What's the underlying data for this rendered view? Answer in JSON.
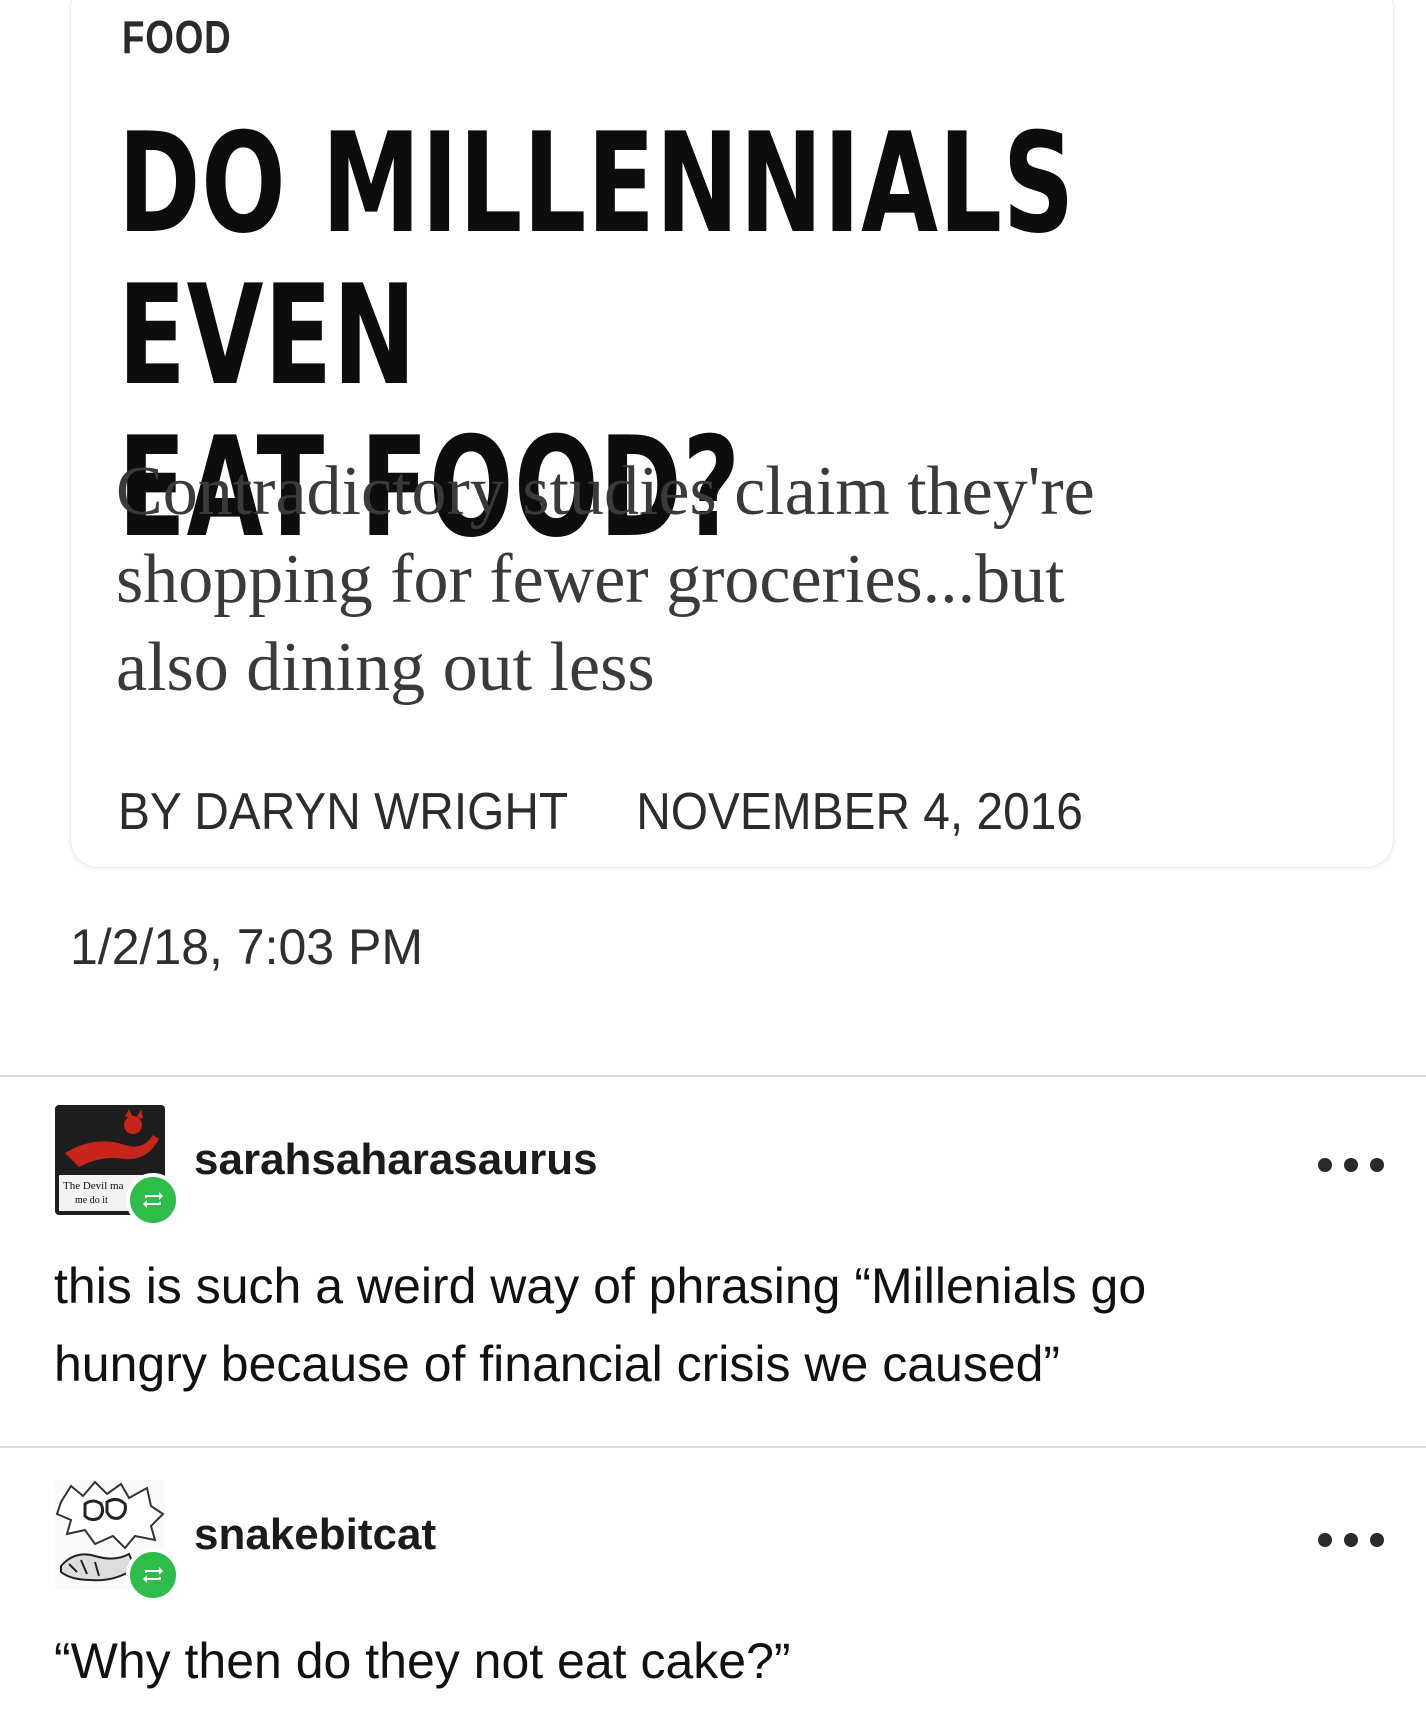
{
  "article": {
    "category": "FOOD",
    "headline_line1": "DO MILLENNIALS EVEN",
    "headline_line2": "EAT FOOD?",
    "dek_line1": "Contradictory studies claim they're",
    "dek_line2": "shopping for fewer groceries...but",
    "dek_line3": "also dining out less",
    "byline": "BY DARYN WRIGHT",
    "date": "NOVEMBER 4, 2016"
  },
  "post": {
    "timestamp": "1/2/18, 7:03 PM"
  },
  "reblogs": [
    {
      "username": "sarahsaharasaurus",
      "avatar_caption_line1": "The Devil ma",
      "avatar_caption_line2": "me do it",
      "body_line1": "this is such a weird way of phrasing “Millenials go",
      "body_line2": "hungry because of financial crisis we caused”"
    },
    {
      "username": "snakebitcat",
      "body_line1": "“Why then do they not eat cake?”"
    }
  ],
  "icons": {
    "reblog_badge": "reblog-icon",
    "more_menu": "more-options-icon"
  },
  "colors": {
    "reblog_badge": "#2ebd4a",
    "divider": "#d8d8d8",
    "headline": "#0d0d0d"
  }
}
